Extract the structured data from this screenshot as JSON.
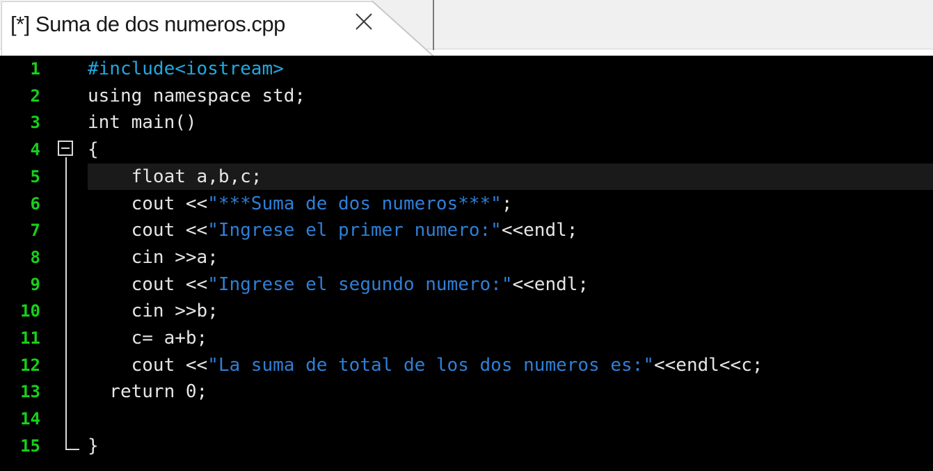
{
  "tab": {
    "title": "[*] Suma de dos numeros.cpp",
    "close_icon": "close-icon"
  },
  "editor": {
    "current_line": 5,
    "colors": {
      "background": "#000000",
      "line_numbers": "#17d01a",
      "preprocessor": "#20a8e0",
      "string": "#2f7fd6",
      "text": "#e6e6e6",
      "current_line_bg": "#1a1a1a"
    },
    "fold_icon": "collapse-minus-icon",
    "lines": [
      {
        "n": "1",
        "segments": [
          {
            "t": "#include<iostream>",
            "c": "pp"
          }
        ]
      },
      {
        "n": "2",
        "segments": [
          {
            "t": "using namespace std;",
            "c": "tx"
          }
        ]
      },
      {
        "n": "3",
        "segments": [
          {
            "t": "int main()",
            "c": "tx"
          }
        ]
      },
      {
        "n": "4",
        "segments": [
          {
            "t": "{",
            "c": "tx"
          }
        ]
      },
      {
        "n": "5",
        "segments": [
          {
            "t": "    float a,b,c;",
            "c": "tx"
          }
        ]
      },
      {
        "n": "6",
        "segments": [
          {
            "t": "    cout <<",
            "c": "tx"
          },
          {
            "t": "\"***Suma de dos numeros***\"",
            "c": "st"
          },
          {
            "t": ";",
            "c": "tx"
          }
        ]
      },
      {
        "n": "7",
        "segments": [
          {
            "t": "    cout <<",
            "c": "tx"
          },
          {
            "t": "\"Ingrese el primer numero:\"",
            "c": "st"
          },
          {
            "t": "<<endl;",
            "c": "tx"
          }
        ]
      },
      {
        "n": "8",
        "segments": [
          {
            "t": "    cin >>a;",
            "c": "tx"
          }
        ]
      },
      {
        "n": "9",
        "segments": [
          {
            "t": "    cout <<",
            "c": "tx"
          },
          {
            "t": "\"Ingrese el segundo numero:\"",
            "c": "st"
          },
          {
            "t": "<<endl;",
            "c": "tx"
          }
        ]
      },
      {
        "n": "10",
        "segments": [
          {
            "t": "    cin >>b;",
            "c": "tx"
          }
        ]
      },
      {
        "n": "11",
        "segments": [
          {
            "t": "    c= a+b;",
            "c": "tx"
          }
        ]
      },
      {
        "n": "12",
        "segments": [
          {
            "t": "    cout <<",
            "c": "tx"
          },
          {
            "t": "\"La suma de total de los dos numeros es:\"",
            "c": "st"
          },
          {
            "t": "<<endl<<c;",
            "c": "tx"
          }
        ]
      },
      {
        "n": "13",
        "segments": [
          {
            "t": "  return 0;",
            "c": "tx"
          }
        ]
      },
      {
        "n": "14",
        "segments": [
          {
            "t": "",
            "c": "tx"
          }
        ]
      },
      {
        "n": "15",
        "segments": [
          {
            "t": "}",
            "c": "tx"
          }
        ]
      }
    ]
  }
}
